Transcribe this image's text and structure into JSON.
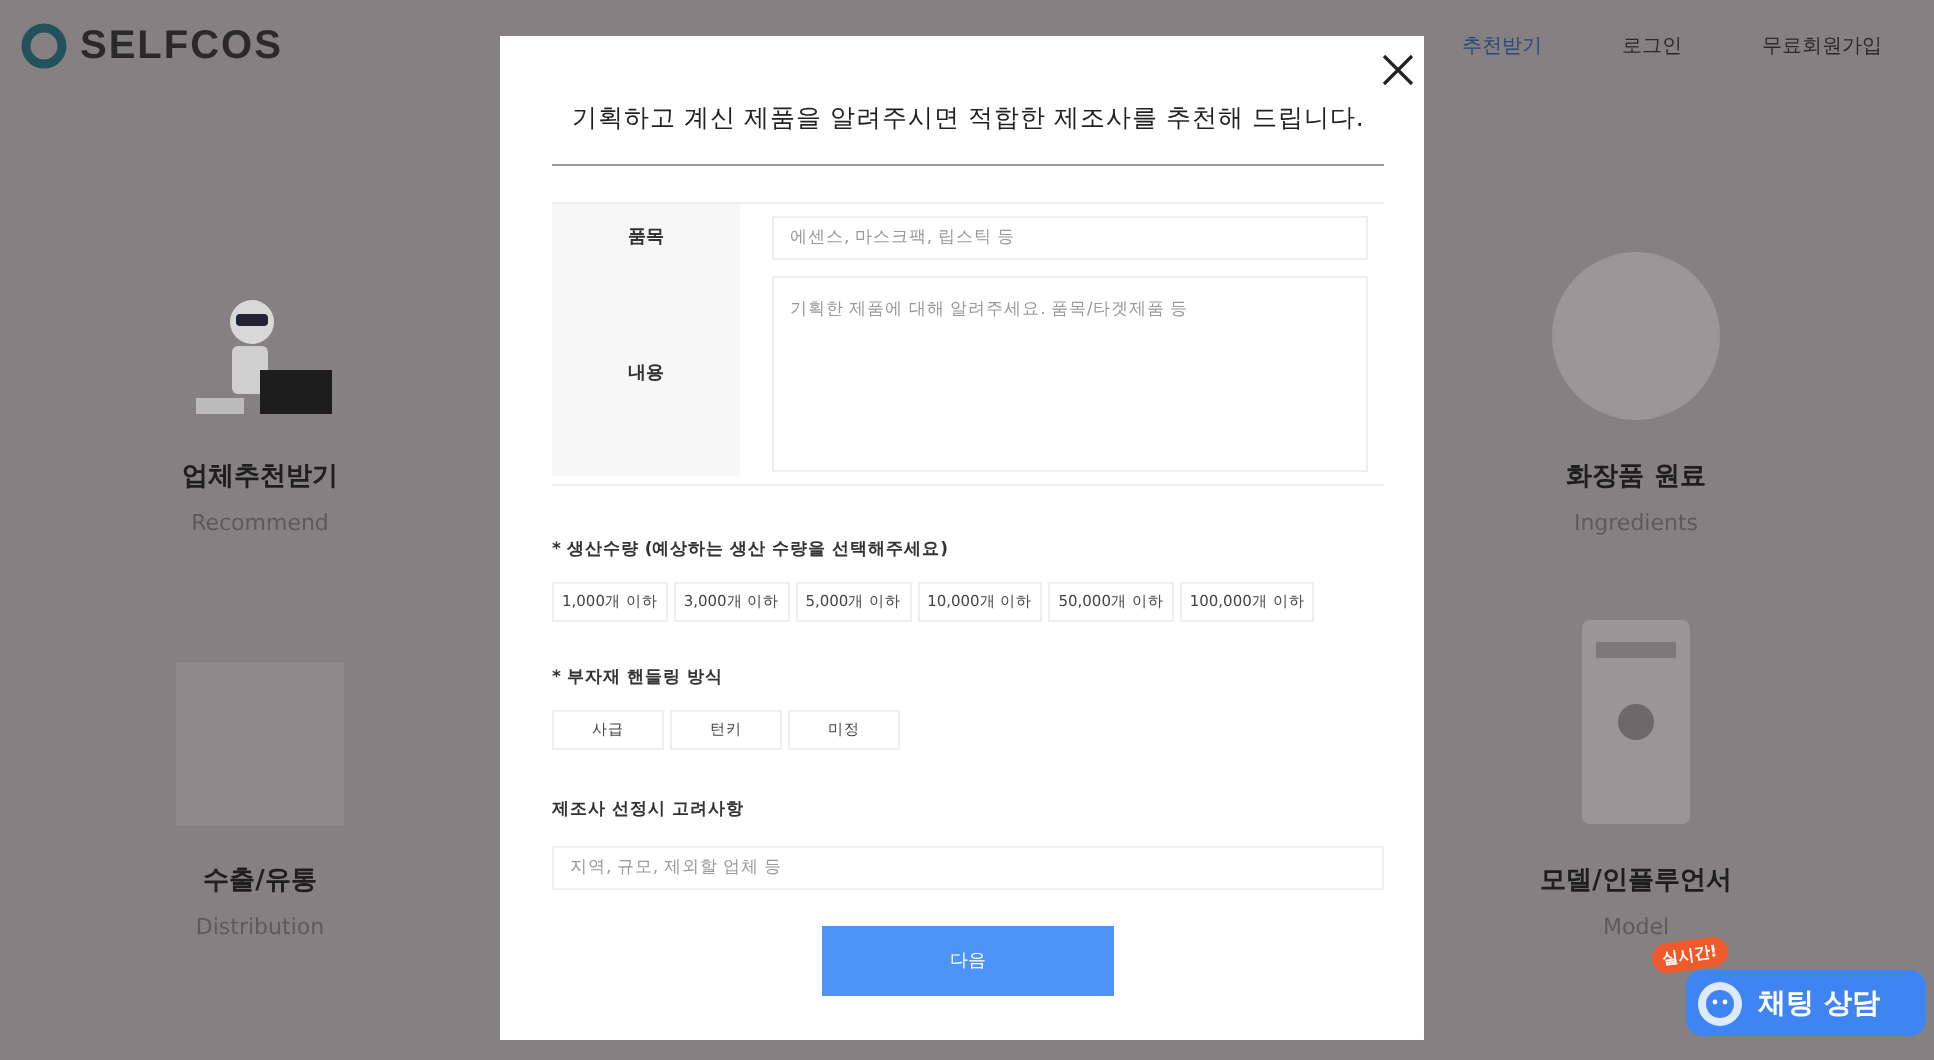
{
  "header": {
    "logo": "SELFCOS",
    "nav": [
      {
        "label": "추천받기",
        "selected": true
      },
      {
        "label": "로그인",
        "selected": false
      },
      {
        "label": "무료회원가입",
        "selected": false
      }
    ]
  },
  "left_services": [
    {
      "title": "업체추천받기",
      "subtitle": "Recommend",
      "kind": "robot"
    },
    {
      "title": "수출/유통",
      "subtitle": "Distribution",
      "kind": "box"
    }
  ],
  "right_services": [
    {
      "title": "화장품 원료",
      "subtitle": "Ingredients",
      "kind": "sphere"
    },
    {
      "title": "모델/인플루언서",
      "subtitle": "Model",
      "kind": "phone"
    }
  ],
  "modal": {
    "title": "기획하고 계신 제품을 알려주시면 적합한 제조사를 추천해 드립니다.",
    "fields": [
      {
        "label": "품목",
        "kind": "input",
        "placeholder": "에센스, 마스크팩, 립스틱 등"
      },
      {
        "label": "내용",
        "kind": "textarea",
        "placeholder": "기획한 제품에 대해 알려주세요. 품목/타겟제품 등"
      }
    ],
    "quantity": {
      "label": "* 생산수량 (예상하는 생산 수량을 선택해주세요)",
      "options": [
        {
          "label": "1,000개 이하",
          "selected": false
        },
        {
          "label": "3,000개 이하",
          "selected": false
        },
        {
          "label": "5,000개 이하",
          "selected": false
        },
        {
          "label": "10,000개 이하",
          "selected": false
        },
        {
          "label": "50,000개 이하",
          "selected": false
        },
        {
          "label": "100,000개 이하",
          "selected": false
        }
      ]
    },
    "handling": {
      "label": "* 부자재 핸들링 방식",
      "options": [
        {
          "label": "사급",
          "selected": false
        },
        {
          "label": "턴키",
          "selected": false
        },
        {
          "label": "미정",
          "selected": false
        }
      ]
    },
    "considerations": {
      "label": "제조사 선정시 고려사항",
      "placeholder": "지역, 규모, 제외할 업체 등"
    },
    "next_button": "다음"
  },
  "chat": {
    "badge": "실시간!",
    "label": "채팅 상담"
  }
}
